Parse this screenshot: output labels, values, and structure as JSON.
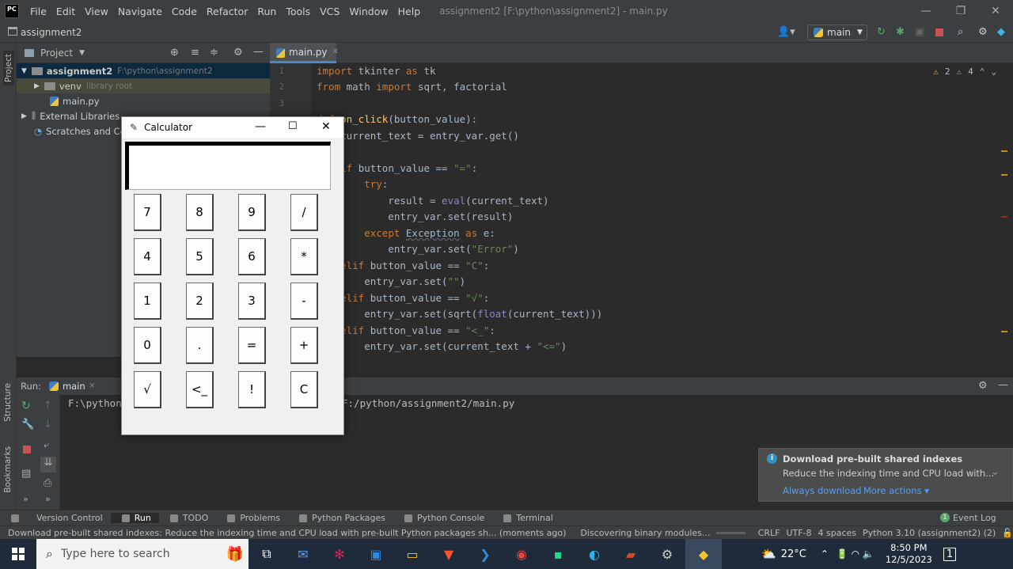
{
  "menubar": {
    "logo": "PC",
    "items": [
      "File",
      "Edit",
      "View",
      "Navigate",
      "Code",
      "Refactor",
      "Run",
      "Tools",
      "VCS",
      "Window",
      "Help"
    ],
    "title": "assignment2 [F:\\python\\assignment2] - main.py"
  },
  "navbar": {
    "project": "assignment2",
    "run_config": "main"
  },
  "project_panel": {
    "header": "Project",
    "tree": [
      {
        "name": "assignment2",
        "hint": "F:\\python\\assignment2"
      },
      {
        "name": "venv",
        "hint": "library root"
      },
      {
        "name": "main.py",
        "hint": ""
      },
      {
        "name": "External Libraries",
        "hint": ""
      },
      {
        "name": "Scratches and Consoles",
        "hint": ""
      }
    ]
  },
  "editor": {
    "tab": "main.py",
    "warnings": "2",
    "weak_warnings": "4",
    "line_numbers": [
      "1",
      "2",
      "3"
    ],
    "code": [
      "import tkinter as tk",
      "from math import sqrt, factorial",
      "",
      "def on_click(button_value):",
      "    current_text = entry_var.get()",
      "",
      "    if button_value == \"=\":",
      "        try:",
      "            result = eval(current_text)",
      "            entry_var.set(result)",
      "        except Exception as e:",
      "            entry_var.set(\"Error\")",
      "    elif button_value == \"C\":",
      "        entry_var.set(\"\")",
      "    elif button_value == \"√\":",
      "        entry_var.set(sqrt(float(current_text)))",
      "    elif button_value == \"<_\":",
      "        entry_var.set(current_text + \"<=\")"
    ]
  },
  "run_panel": {
    "label": "Run:",
    "tab": "main",
    "output_prefix": "F:\\python",
    "output_suffix": "F:/python/assignment2/main.py"
  },
  "calculator": {
    "title": "Calculator",
    "buttons": [
      [
        "7",
        "8",
        "9",
        "/"
      ],
      [
        "4",
        "5",
        "6",
        "*"
      ],
      [
        "1",
        "2",
        "3",
        "-"
      ],
      [
        "0",
        ".",
        "=",
        "+"
      ],
      [
        "√",
        "<_",
        "!",
        "C"
      ]
    ]
  },
  "notification": {
    "title": "Download pre-built shared indexes",
    "body": "Reduce the indexing time and CPU load with...",
    "action1": "Always download",
    "action2": "More actions ▾"
  },
  "tool_windows": [
    "Version Control",
    "Run",
    "TODO",
    "Problems",
    "Python Packages",
    "Python Console",
    "Terminal"
  ],
  "event_log": "Event Log",
  "status": {
    "message": "Download pre-built shared indexes: Reduce the indexing time and CPU load with pre-built Python packages sh... (moments ago)",
    "task": "Discovering binary modules...",
    "line_sep": "CRLF",
    "encoding": "UTF-8",
    "indent": "4 spaces",
    "interpreter": "Python 3.10 (assignment2) (2)"
  },
  "taskbar": {
    "search_placeholder": "Type here to search",
    "temperature": "22°C",
    "time": "8:50 PM",
    "date": "12/5/2023",
    "notif_count": "1"
  }
}
